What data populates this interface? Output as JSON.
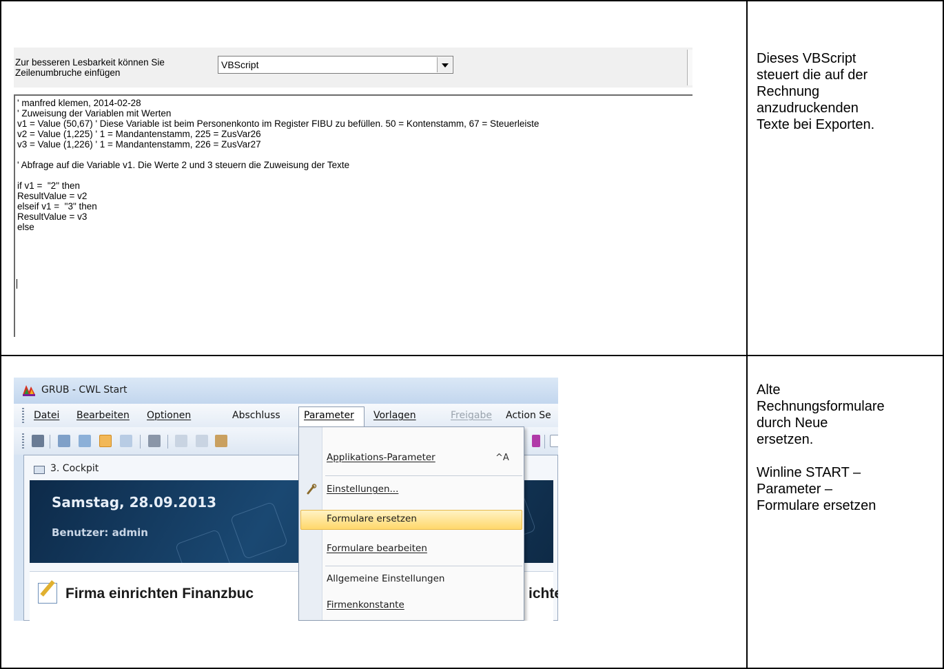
{
  "vbscript_panel": {
    "hint_line1": "Zur besseren Lesbarkeit können Sie",
    "hint_line2": "Zeilenumbruche einfügen",
    "language_selected": "VBScript",
    "code": "' manfred klemen, 2014-02-28\n' Zuweisung der Variablen mit Werten\nv1 = Value (50,67) ' Diese Variable ist beim Personenkonto im Register FIBU zu befüllen. 50 = Kontenstamm, 67 = Steuerleiste\nv2 = Value (1,225) ' 1 = Mandantenstamm, 225 = ZusVar26\nv3 = Value (1,226) ' 1 = Mandantenstamm, 226 = ZusVar27\n\n' Abfrage auf die Variable v1. Die Werte 2 und 3 steuern die Zuweisung der Texte\n\nif v1 =  \"2\" then\nResultValue = v2\nelseif v1 =  \"3\" then\nResultValue = v3\nelse"
  },
  "description_1": {
    "lines": [
      "Dieses VBScript",
      "steuert die auf der",
      "Rechnung",
      "anzudruckenden",
      "Texte bei Exporten."
    ]
  },
  "winline": {
    "window_title": "GRUB - CWL Start",
    "menu": [
      "Datei",
      "Bearbeiten",
      "Optionen",
      "Abschluss",
      "Parameter",
      "Vorlagen",
      "Freigabe",
      "Action Se"
    ],
    "cockpit_title": "3. Cockpit",
    "date": "Samstag, 28.09.2013",
    "user": "Benutzer: admin",
    "card_left": "Firma einrichten Finanzbuc",
    "card_right": "ichte",
    "dropdown": {
      "items": [
        "Applikations-Parameter",
        "Einstellungen...",
        "Formulare ersetzen",
        "Formulare bearbeiten",
        "Allgemeine Einstellungen",
        "Firmenkonstante"
      ],
      "shortcut": "^A",
      "highlighted": "Formulare ersetzen"
    }
  },
  "description_2": {
    "para1": [
      "Alte",
      "Rechnungsformulare",
      "durch Neue",
      "ersetzen."
    ],
    "para2": [
      "Winline START –",
      "Parameter –",
      "Formulare ersetzen"
    ]
  }
}
